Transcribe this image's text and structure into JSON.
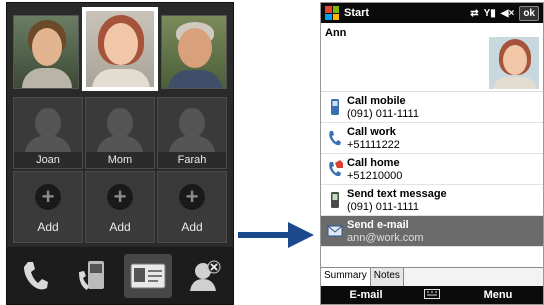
{
  "left_phone": {
    "contacts_row2": [
      {
        "name": "Joan"
      },
      {
        "name": "Mom"
      },
      {
        "name": "Farah"
      }
    ],
    "add_cells": [
      {
        "label": "Add"
      },
      {
        "label": "Add"
      },
      {
        "label": "Add"
      }
    ],
    "bottom_bar_icons": [
      "phone-icon",
      "phone-handset-icon",
      "contact-card-icon",
      "remove-contact-icon"
    ]
  },
  "right_phone": {
    "titlebar": {
      "title": "Start",
      "ok_label": "ok"
    },
    "contact": {
      "name": "Ann"
    },
    "actions": [
      {
        "title": "Call mobile",
        "value": "(091) 011-1111",
        "icon": "mobile-phone-icon"
      },
      {
        "title": "Call work",
        "value": "+51111222",
        "icon": "work-phone-icon"
      },
      {
        "title": "Call home",
        "value": "+51210000",
        "icon": "home-phone-icon"
      },
      {
        "title": "Send text message",
        "value": "(091) 011-1111",
        "icon": "text-message-icon"
      },
      {
        "title": "Send e-mail",
        "value": "ann@work.com",
        "icon": "email-icon"
      }
    ],
    "tabs": [
      {
        "label": "Summary"
      },
      {
        "label": "Notes"
      }
    ],
    "softkeys": {
      "left": "E-mail",
      "right": "Menu"
    }
  },
  "colors": {
    "left_bg": "#2a2a2a",
    "selected_row": "#6b6b6b",
    "arrow": "#1a4a8c",
    "titlebar": "#0b0b0b"
  }
}
